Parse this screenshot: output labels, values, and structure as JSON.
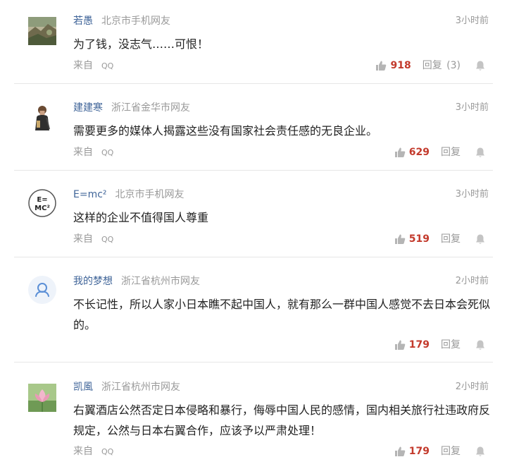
{
  "comments": [
    {
      "username": "若愚",
      "location": "北京市手机网友",
      "time": "3小时前",
      "text": "为了钱，没志气……可恨！",
      "source_label": "来自",
      "source_app": "QQ",
      "likes": "918",
      "reply_label": "回复",
      "reply_count": "(3)",
      "avatar_icon": "landscape-photo-avatar"
    },
    {
      "username": "建建寒",
      "location": "浙江省金华市网友",
      "time": "3小时前",
      "text": "需要更多的媒体人揭露这些没有国家社会责任感的无良企业。",
      "source_label": "来自",
      "source_app": "QQ",
      "likes": "629",
      "reply_label": "回复",
      "avatar_icon": "person-photo-avatar"
    },
    {
      "username": "E=mc²",
      "location": "北京市手机网友",
      "time": "3小时前",
      "text": "这样的企业不值得国人尊重",
      "source_label": "来自",
      "source_app": "QQ",
      "likes": "519",
      "reply_label": "回复",
      "avatar_icon": "emc2-avatar",
      "avatar_text_top": "E=",
      "avatar_text_bottom": "MC²"
    },
    {
      "username": "我的梦想",
      "location": "浙江省杭州市网友",
      "time": "2小时前",
      "text": "不长记性，所以人家小日本瞧不起中国人，就有那么一群中国人感觉不去日本会死似的。",
      "source_label": "",
      "source_app": "",
      "likes": "179",
      "reply_label": "回复",
      "avatar_icon": "default-user-avatar"
    },
    {
      "username": "凯風",
      "location": "浙江省杭州市网友",
      "time": "2小时前",
      "text": "右翼酒店公然否定日本侵略和暴行，侮辱中国人民的感情，国内相关旅行社违政府反规定，公然与日本右翼合作，应该予以严肃处理！",
      "source_label": "来自",
      "source_app": "QQ",
      "likes": "179",
      "reply_label": "回复",
      "avatar_icon": "lotus-photo-avatar"
    }
  ],
  "colors": {
    "username": "#406599",
    "likes": "#c33a2c",
    "muted": "#999999",
    "divider": "#e6e6e6"
  }
}
